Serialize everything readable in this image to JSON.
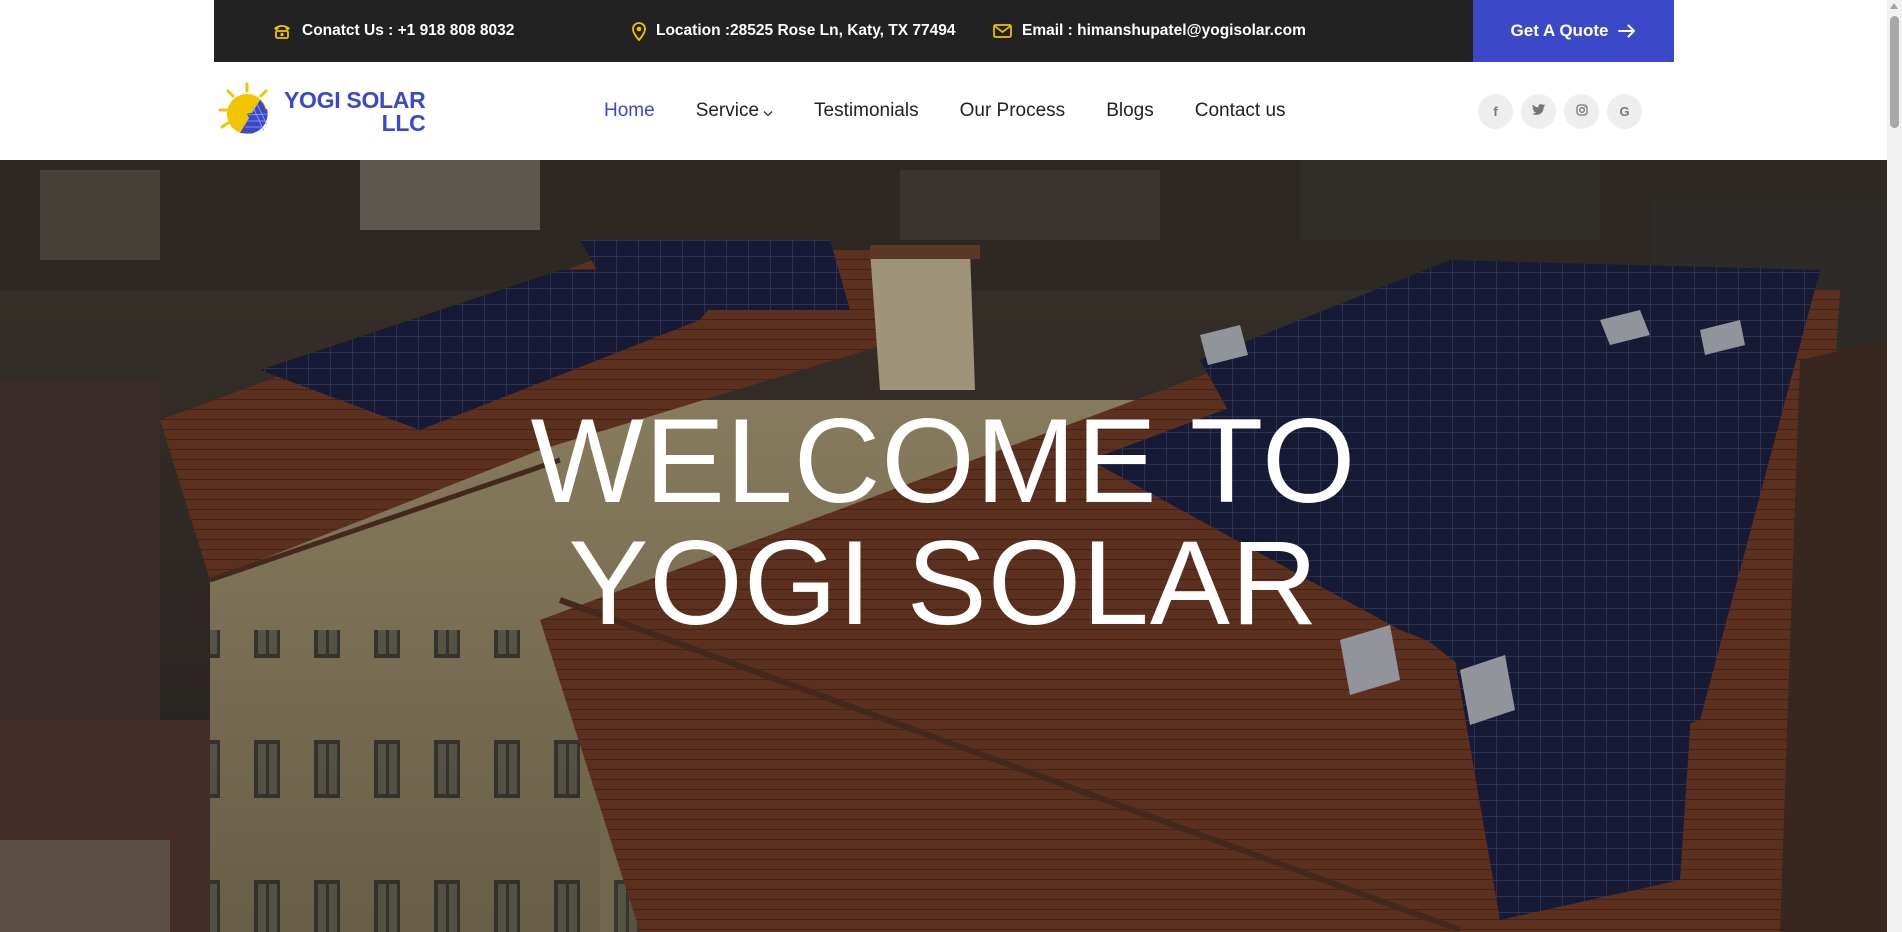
{
  "topbar": {
    "contact": "Conatct Us : +1 918 808 8032",
    "location": "Location :28525 Rose Ln, Katy, TX 77494",
    "email": "Email : himanshupatel@yogisolar.com",
    "quote_label": "Get A Quote",
    "icons": [
      "phone-icon",
      "map-pin-icon",
      "envelope-icon",
      "arrow-right-icon"
    ],
    "icon_color": "#f2c300"
  },
  "logo": {
    "line1": "YOGI SOLAR",
    "line2": "LLC"
  },
  "nav": {
    "items": [
      {
        "label": "Home",
        "active": true
      },
      {
        "label": "Service",
        "dropdown": true
      },
      {
        "label": "Testimonials"
      },
      {
        "label": "Our Process"
      },
      {
        "label": "Blogs"
      },
      {
        "label": "Contact us"
      }
    ]
  },
  "socials": {
    "facebook": "f",
    "google": "G",
    "icons": [
      "facebook-icon",
      "twitter-icon",
      "instagram-icon",
      "google-icon"
    ]
  },
  "hero": {
    "line1": "WELCOME TO",
    "line2": "YOGI SOLAR"
  },
  "colors": {
    "accent": "#3b48c8",
    "topbar_bg": "#222222",
    "icon_yellow": "#f2c300"
  }
}
